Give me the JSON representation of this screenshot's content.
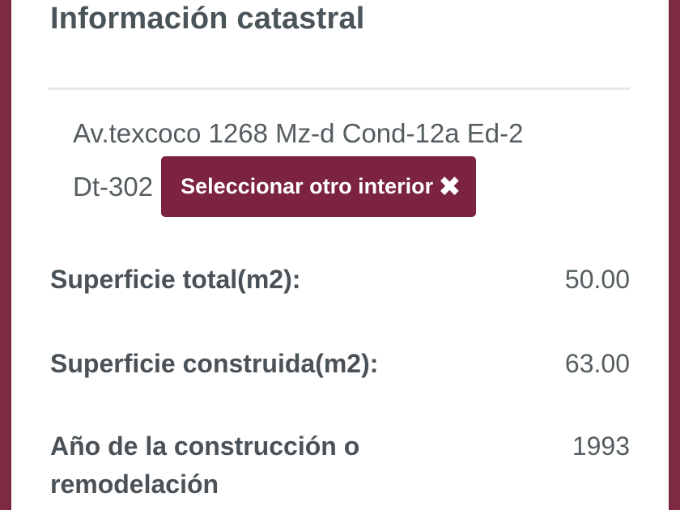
{
  "panel": {
    "title": "Información catastral",
    "address": {
      "line1": "Av.texcoco 1268 Mz-d Cond-12a Ed-2",
      "line2": "Dt-302"
    },
    "select_button": {
      "label": "Seleccionar otro interior",
      "icon": "close-icon",
      "color": "#7b2340"
    },
    "fields": [
      {
        "label": "Superficie total(m2):",
        "value": "50.00"
      },
      {
        "label": "Superficie construida(m2):",
        "value": "63.00"
      },
      {
        "label": "Año de la construcción o remodelación",
        "value": "1993"
      }
    ]
  }
}
